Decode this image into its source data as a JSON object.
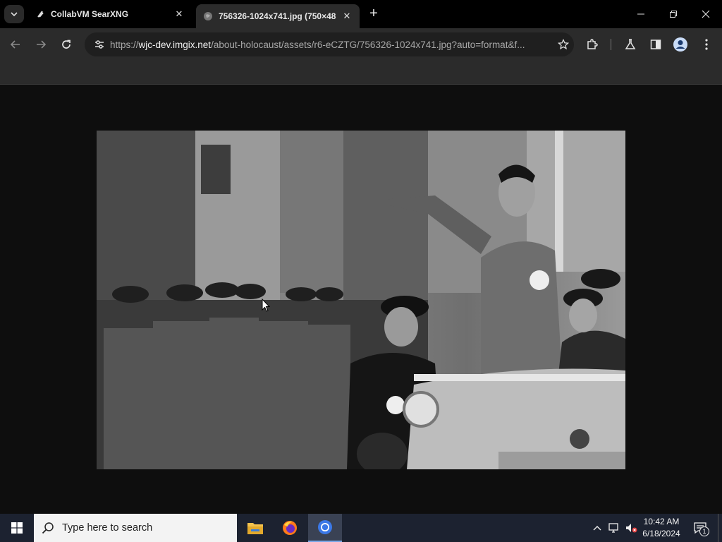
{
  "browser": {
    "tabs": [
      {
        "title": "CollabVM SearXNG",
        "active": false
      },
      {
        "title": "756326-1024x741.jpg (750×48",
        "active": true
      }
    ],
    "address": {
      "scheme": "https://",
      "host": "wjc-dev.imgix.net",
      "path": "/about-holocaust/assets/r6-eCZTG/756326-1024x741.jpg?auto=format&f..."
    }
  },
  "taskbar": {
    "search_placeholder": "Type here to search",
    "time": "10:42 AM",
    "date": "6/18/2024",
    "notification_count": "1"
  },
  "colors": {
    "tab_strip": "#000000",
    "toolbar": "#2b2b2b",
    "page_bg": "#0e0e0e",
    "taskbar": "#1c2230"
  }
}
